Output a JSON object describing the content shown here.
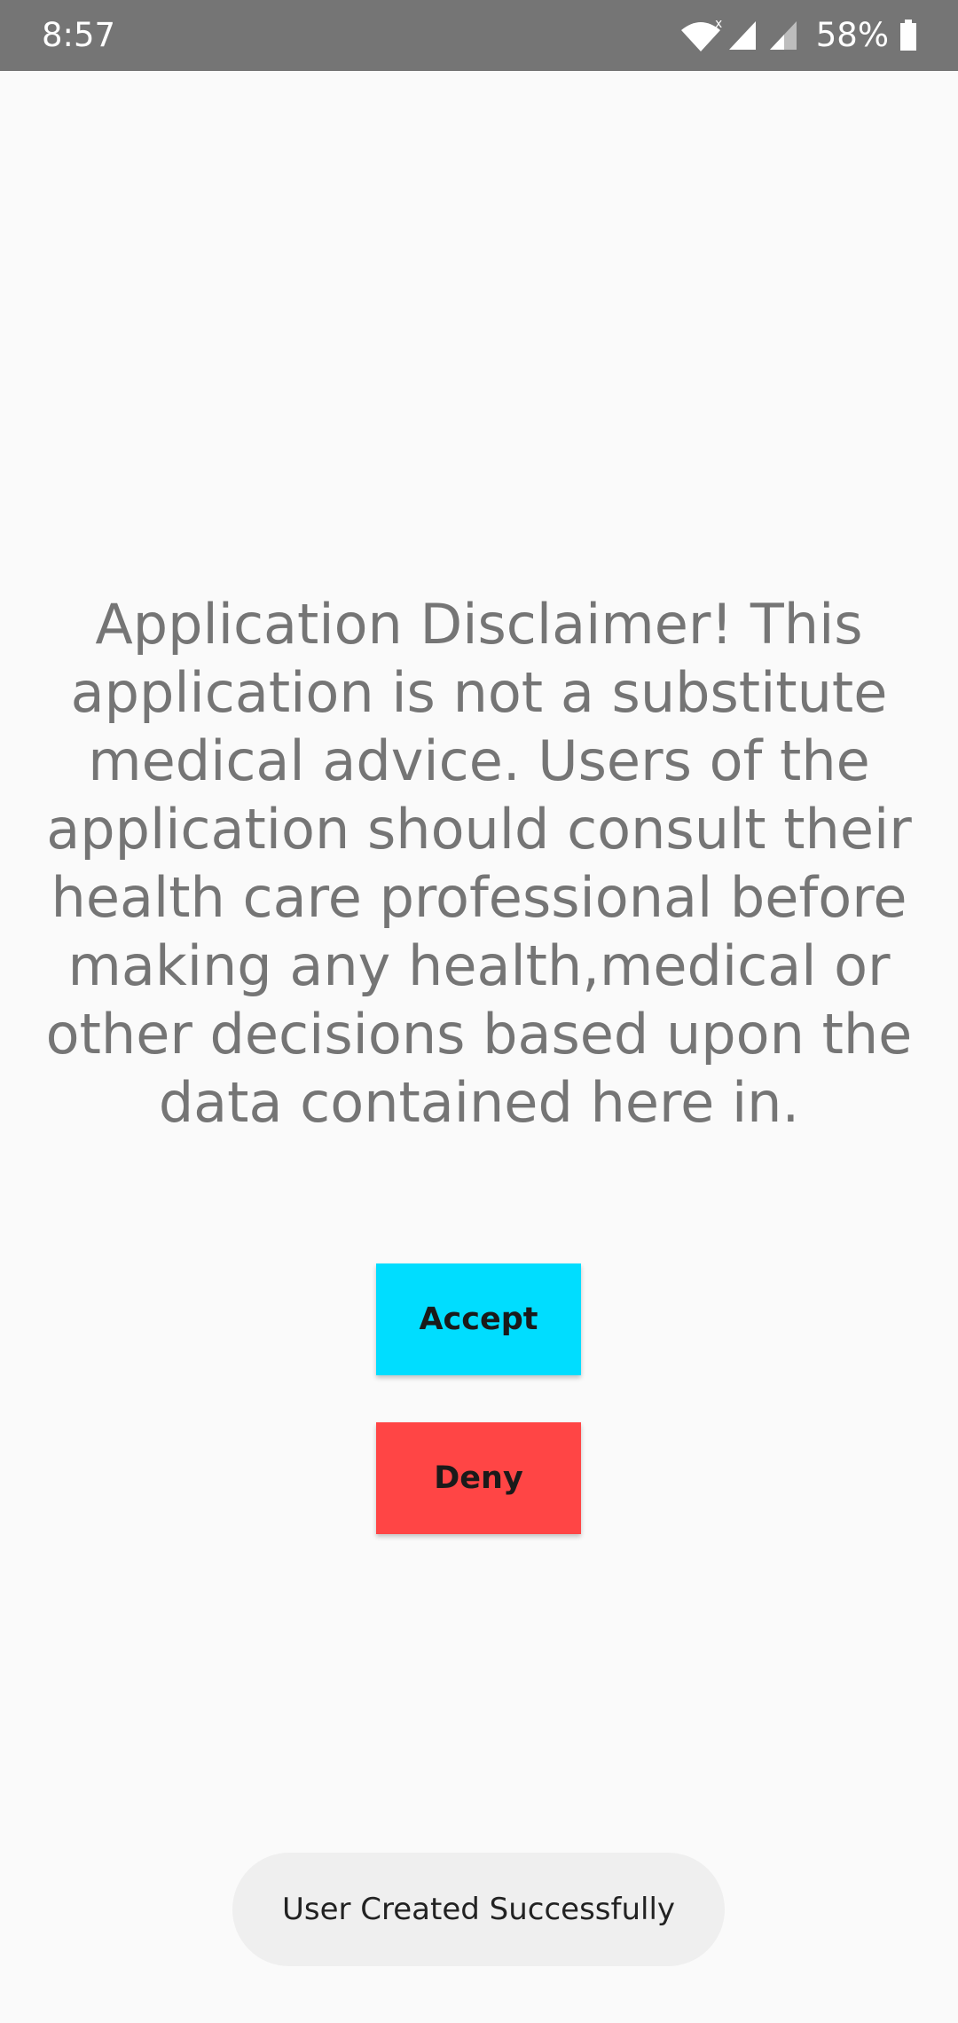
{
  "status_bar": {
    "time": "8:57",
    "battery_percent": "58%",
    "icons": [
      "wifi-icon",
      "cellular-signal-icon",
      "cellular-signal-icon",
      "battery-icon"
    ],
    "background_color": "#757575"
  },
  "disclaimer": {
    "text": "Application Disclaimer! This application is not a substitute medical advice. Users of the application should consult their health care professional before making any health,medical or other decisions based upon the data contained here in."
  },
  "buttons": {
    "accept_label": "Accept",
    "deny_label": "Deny",
    "accept_color": "#00ddff",
    "deny_color": "#ff4545"
  },
  "toast": {
    "message": "User Created Successfully"
  }
}
